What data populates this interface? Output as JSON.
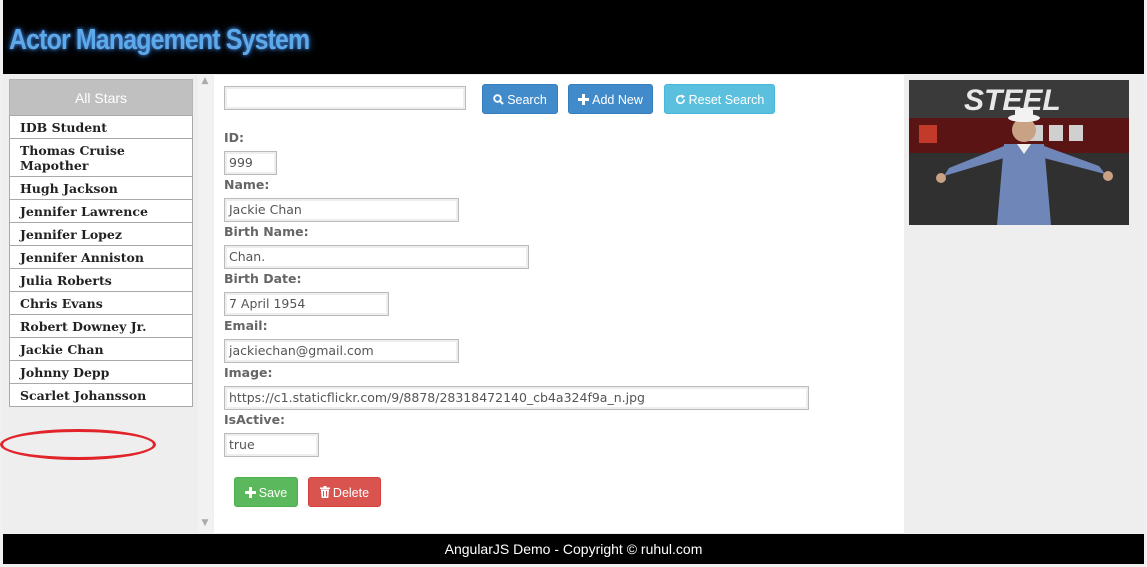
{
  "header": {
    "title": "Actor Management System"
  },
  "sidebar": {
    "title": "All Stars",
    "items": [
      "IDB Student",
      "Thomas Cruise Mapother",
      "Hugh Jackson",
      "Jennifer Lawrence",
      "Jennifer Lopez",
      "Jennifer Anniston",
      "Julia Roberts",
      "Chris Evans",
      "Robert Downey Jr.",
      "Jackie Chan",
      "Johnny Depp",
      "Scarlet Johansson"
    ],
    "highlighted": "Jackie Chan"
  },
  "toolbar": {
    "search_value": "",
    "search_label": "Search",
    "add_label": "Add New",
    "reset_label": "Reset Search"
  },
  "form": {
    "id_label": "ID:",
    "id_value": "999",
    "name_label": "Name:",
    "name_value": "Jackie Chan",
    "birthname_label": "Birth Name:",
    "birthname_value": "Chan.",
    "birthdate_label": "Birth Date:",
    "birthdate_value": "7 April 1954",
    "email_label": "Email:",
    "email_value": "jackiechan@gmail.com",
    "image_label": "Image:",
    "image_value": "https://c1.staticflickr.com/9/8878/28318472140_cb4a324f9a_n.jpg",
    "active_label": "IsActive:",
    "active_value": "true",
    "save_label": "Save",
    "delete_label": "Delete"
  },
  "photo": {
    "banner_text": "STEEL"
  },
  "footer": {
    "text": "AngularJS Demo - Copyright © ruhul.com"
  },
  "colors": {
    "primary": "#428bca",
    "info": "#5bc0de",
    "success": "#5cb85c",
    "danger": "#d9534f",
    "title_blue": "#5ea9ea",
    "highlight_red": "#e1232a"
  }
}
